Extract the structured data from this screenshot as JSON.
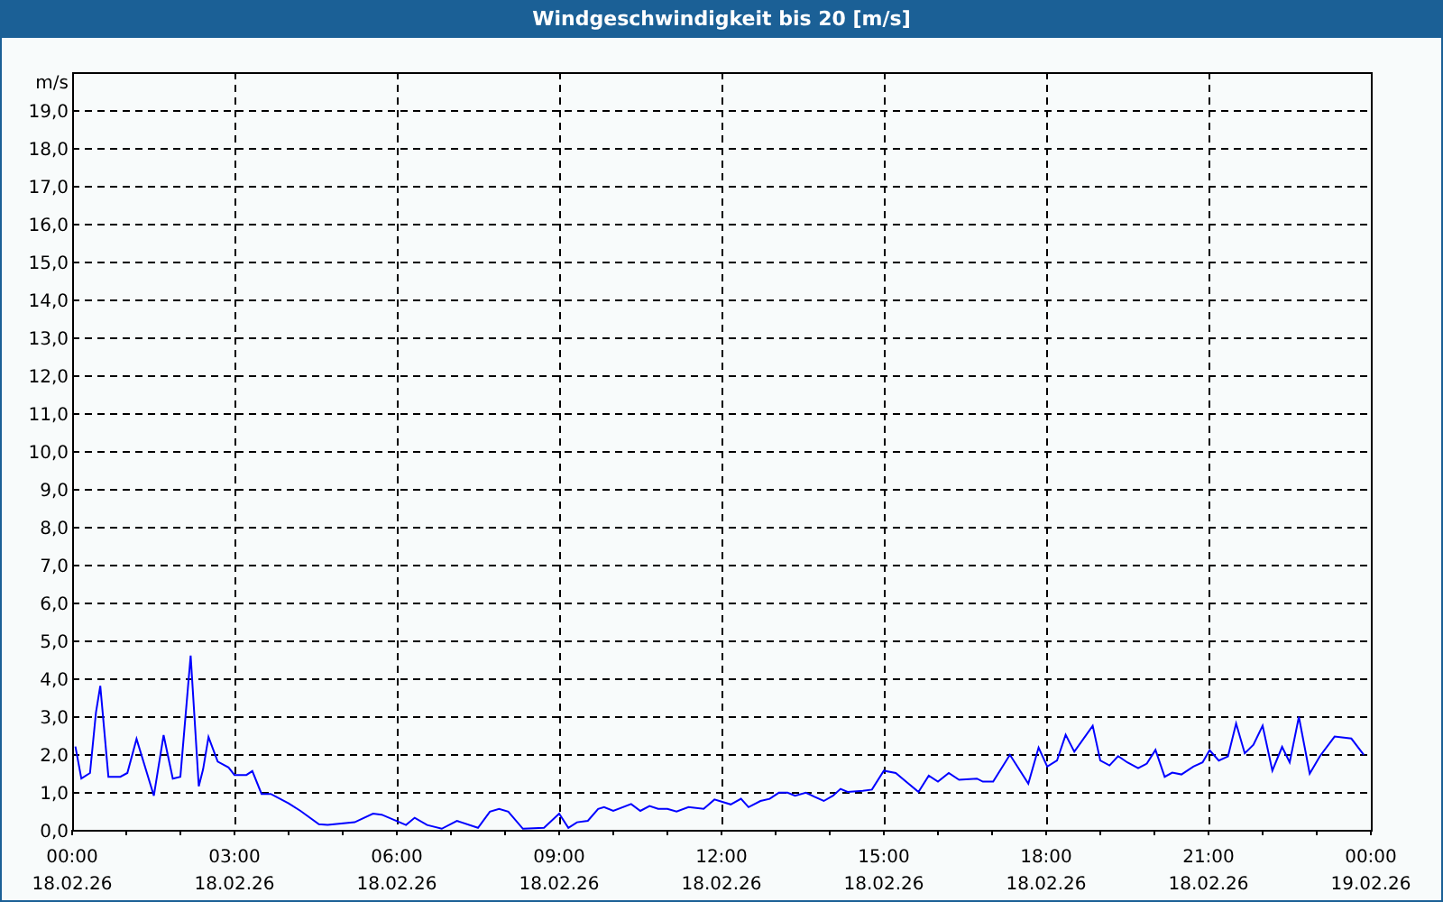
{
  "window": {
    "title": "Windgeschwindigkeit bis 20 [m/s]"
  },
  "chart": {
    "xtick_dates": [
      "18.02.26",
      "18.02.26",
      "18.02.26",
      "18.02.26",
      "18.02.26",
      "18.02.26",
      "18.02.26",
      "18.02.26",
      "19.02.26"
    ],
    "chart_data": {
      "type": "line",
      "grid": true,
      "ylabel": "m/s",
      "xlim": [
        0,
        24
      ],
      "ylim": [
        0,
        20
      ],
      "xticks": [
        {
          "value": 0,
          "label": "00:00"
        },
        {
          "value": 3,
          "label": "03:00"
        },
        {
          "value": 6,
          "label": "06:00"
        },
        {
          "value": 9,
          "label": "09:00"
        },
        {
          "value": 12,
          "label": "12:00"
        },
        {
          "value": 15,
          "label": "15:00"
        },
        {
          "value": 18,
          "label": "18:00"
        },
        {
          "value": 21,
          "label": "21:00"
        },
        {
          "value": 24,
          "label": "00:00"
        }
      ],
      "yticks": [
        {
          "value": 0,
          "label": "0,0"
        },
        {
          "value": 1,
          "label": "1,0"
        },
        {
          "value": 2,
          "label": "2,0"
        },
        {
          "value": 3,
          "label": "3,0"
        },
        {
          "value": 4,
          "label": "4,0"
        },
        {
          "value": 5,
          "label": "5,0"
        },
        {
          "value": 6,
          "label": "6,0"
        },
        {
          "value": 7,
          "label": "7,0"
        },
        {
          "value": 8,
          "label": "8,0"
        },
        {
          "value": 9,
          "label": "9,0"
        },
        {
          "value": 10,
          "label": "10,0"
        },
        {
          "value": 11,
          "label": "11,0"
        },
        {
          "value": 12,
          "label": "12,0"
        },
        {
          "value": 13,
          "label": "13,0"
        },
        {
          "value": 14,
          "label": "14,0"
        },
        {
          "value": 15,
          "label": "15,0"
        },
        {
          "value": 16,
          "label": "16,0"
        },
        {
          "value": 17,
          "label": "17,0"
        },
        {
          "value": 18,
          "label": "18,0"
        },
        {
          "value": 19,
          "label": "19,0"
        }
      ],
      "x": [
        0.06,
        0.17,
        0.33,
        0.44,
        0.52,
        0.67,
        0.89,
        1.02,
        1.19,
        1.51,
        1.69,
        1.86,
        2.0,
        2.19,
        2.34,
        2.42,
        2.52,
        2.69,
        2.89,
        3.0,
        3.22,
        3.33,
        3.5,
        3.67,
        4.0,
        4.22,
        4.56,
        4.72,
        5.22,
        5.56,
        5.72,
        6.17,
        6.33,
        6.56,
        6.83,
        7.11,
        7.5,
        7.72,
        7.89,
        8.06,
        8.33,
        8.72,
        9.0,
        9.17,
        9.33,
        9.53,
        9.72,
        9.83,
        10.0,
        10.33,
        10.5,
        10.67,
        10.83,
        11.0,
        11.17,
        11.39,
        11.67,
        11.87,
        12.17,
        12.36,
        12.5,
        12.72,
        12.89,
        13.06,
        13.22,
        13.36,
        13.56,
        13.72,
        13.89,
        14.06,
        14.2,
        14.33,
        14.61,
        14.78,
        15.0,
        15.22,
        15.44,
        15.64,
        15.83,
        16.0,
        16.2,
        16.39,
        16.72,
        16.83,
        17.02,
        17.33,
        17.67,
        17.86,
        18.02,
        18.2,
        18.36,
        18.52,
        18.86,
        19.0,
        19.17,
        19.33,
        19.5,
        19.7,
        19.86,
        20.02,
        20.19,
        20.33,
        20.5,
        20.72,
        20.89,
        21.02,
        21.19,
        21.36,
        21.51,
        21.67,
        21.83,
        22.0,
        22.18,
        22.36,
        22.5,
        22.67,
        22.87,
        23.06,
        23.33,
        23.64,
        23.87
      ],
      "series": [
        {
          "color": "#0000ff",
          "values": [
            2.2,
            1.35,
            1.5,
            3.1,
            3.8,
            1.4,
            1.4,
            1.5,
            2.4,
            0.9,
            2.5,
            1.35,
            1.4,
            4.6,
            1.15,
            1.6,
            2.45,
            1.8,
            1.65,
            1.45,
            1.45,
            1.55,
            0.95,
            0.95,
            0.7,
            0.5,
            0.15,
            0.13,
            0.2,
            0.43,
            0.4,
            0.13,
            0.32,
            0.13,
            0.03,
            0.24,
            0.05,
            0.48,
            0.55,
            0.48,
            0.03,
            0.05,
            0.43,
            0.05,
            0.2,
            0.24,
            0.55,
            0.6,
            0.5,
            0.68,
            0.5,
            0.63,
            0.55,
            0.55,
            0.48,
            0.6,
            0.55,
            0.8,
            0.67,
            0.82,
            0.6,
            0.76,
            0.82,
            0.98,
            0.98,
            0.9,
            0.98,
            0.87,
            0.76,
            0.9,
            1.08,
            1.0,
            1.03,
            1.06,
            1.56,
            1.5,
            1.24,
            1.0,
            1.43,
            1.27,
            1.5,
            1.32,
            1.35,
            1.27,
            1.27,
            1.98,
            1.22,
            2.17,
            1.67,
            1.83,
            2.51,
            2.06,
            2.75,
            1.83,
            1.7,
            1.95,
            1.78,
            1.63,
            1.75,
            2.11,
            1.4,
            1.51,
            1.46,
            1.67,
            1.78,
            2.1,
            1.83,
            1.94,
            2.81,
            2.02,
            2.25,
            2.75,
            1.56,
            2.19,
            1.78,
            2.98,
            1.48,
            1.95,
            2.46,
            2.41,
            1.98
          ]
        }
      ]
    }
  }
}
